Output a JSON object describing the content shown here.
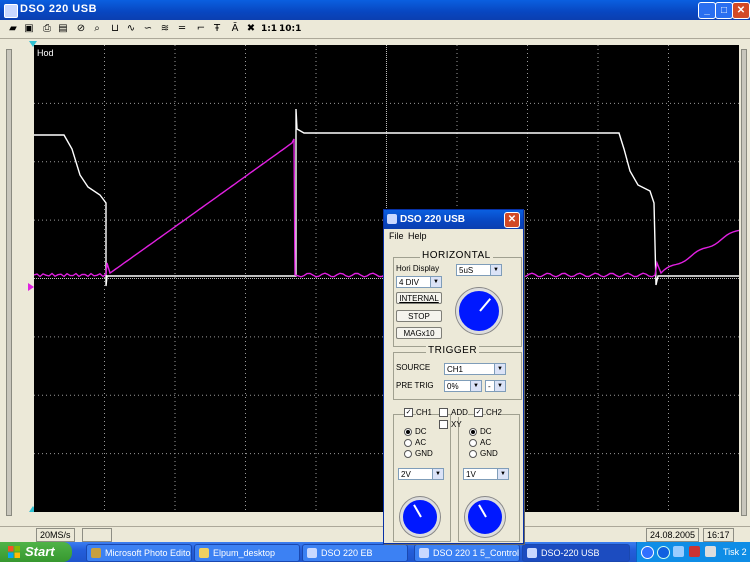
{
  "window": {
    "title": "DSO 220 USB",
    "min": "_",
    "max": "□",
    "close": "✕"
  },
  "toolbar": {
    "icons": [
      "open-icon",
      "save-icon",
      "print-icon",
      "probe-icon",
      "stop-icon",
      "zoom-icon",
      "cursor-icon",
      "wave-icon",
      "wave2-icon",
      "fft-icon",
      "line-icon",
      "marker-icon",
      "freq-icon",
      "amp-icon",
      "clear-icon"
    ],
    "ratio1": "1:1",
    "ratio2": "10:1"
  },
  "scope": {
    "mode_label": "Hod",
    "bg_color": "#000000",
    "grid_color": "#9a9a9a",
    "ch1_color": "#ffffff",
    "ch2_color": "#e020e0"
  },
  "status": {
    "rate": "20MS/s",
    "date": "24.08.2005",
    "time": "16:17"
  },
  "panel": {
    "title": "DSO 220 USB",
    "close": "✕",
    "menu": [
      "File",
      "Help"
    ],
    "horizontal": {
      "title": "HORIZONTAL",
      "hori_display_label": "Hori Display",
      "hori_display_value": "4 DIV",
      "timebase_value": "5uS",
      "btn_intern": "INTERNAL",
      "btn_stop": "STOP",
      "btn_mag": "MAGx10"
    },
    "trigger": {
      "title": "TRIGGER",
      "source_label": "SOURCE",
      "source_value": "CH1",
      "pretrig_label": "PRE TRIG",
      "pretrig_value": "0%",
      "slope_value": "-"
    },
    "channels": {
      "ch1_label": "CH1",
      "add_label": "ADD",
      "ch2_label": "CH2",
      "xy_label": "XY",
      "ch1_coupling": [
        "DC",
        "AC",
        "GND"
      ],
      "ch2_coupling": [
        "DC",
        "AC",
        "GND"
      ],
      "ch1_volts": "2V",
      "ch2_volts": "1V"
    }
  },
  "taskbar": {
    "start": "Start",
    "items": [
      "Microsoft Photo Editor",
      "Elpum_desktop",
      "DSO 220 EB",
      "DSO 220 1 5_Control",
      "DSO-220 USB"
    ],
    "tray_text": "Tisk 2"
  }
}
